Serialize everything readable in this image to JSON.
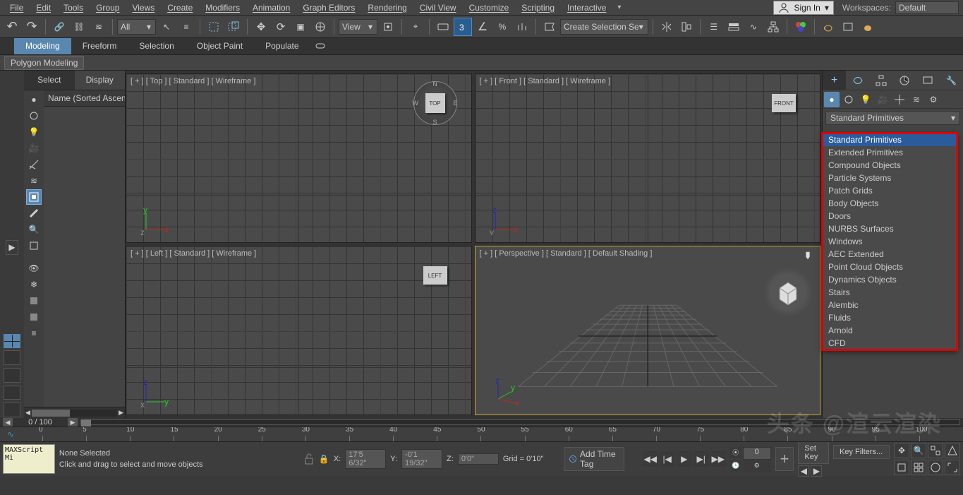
{
  "menubar": {
    "items": [
      "File",
      "Edit",
      "Tools",
      "Group",
      "Views",
      "Create",
      "Modifiers",
      "Animation",
      "Graph Editors",
      "Rendering",
      "Civil View",
      "Customize",
      "Scripting",
      "Interactive"
    ],
    "sign_in": "Sign In",
    "workspaces_label": "Workspaces:",
    "workspace_value": "Default"
  },
  "toolbar": {
    "all_filter": "All",
    "view_filter": "View",
    "named_sel": "Create Selection Se"
  },
  "ribbon": {
    "tabs": [
      "Modeling",
      "Freeform",
      "Selection",
      "Object Paint",
      "Populate"
    ],
    "active": 0,
    "panel": "Polygon Modeling"
  },
  "scene_explorer": {
    "tabs": [
      "Select",
      "Display"
    ],
    "active_tab": 0,
    "column": "Name (Sorted Ascending)"
  },
  "viewports": [
    {
      "label": "[ + ] [ Top ] [ Standard ] [ Wireframe ]",
      "cube": "TOP",
      "active": false
    },
    {
      "label": "[ + ] [ Front ] [ Standard ] [ Wireframe ]",
      "cube": "FRONT",
      "active": false
    },
    {
      "label": "[ + ] [ Left ] [ Standard ] [ Wireframe ]",
      "cube": "LEFT",
      "active": false
    },
    {
      "label": "[ + ] [ Perspective ] [ Standard ] [ Default Shading ]",
      "cube": "",
      "active": true
    }
  ],
  "command_panel": {
    "category_label": "Standard Primitives",
    "dropdown": {
      "items": [
        "Standard Primitives",
        "Extended Primitives",
        "Compound Objects",
        "Particle Systems",
        "Patch Grids",
        "Body Objects",
        "Doors",
        "NURBS Surfaces",
        "Windows",
        "AEC Extended",
        "Point Cloud Objects",
        "Dynamics Objects",
        "Stairs",
        "Alembic",
        "Fluids",
        "Arnold",
        "CFD"
      ],
      "selected": 0
    }
  },
  "timeline": {
    "frame_label": "0 / 100",
    "ruler_major": [
      0,
      5,
      10,
      15,
      20,
      25,
      30,
      35,
      40,
      45,
      50,
      55,
      60,
      65,
      70,
      75,
      80,
      85,
      90,
      95,
      100
    ]
  },
  "status": {
    "maxscript": "MAXScript Mi",
    "selection": "None Selected",
    "prompt": "Click and drag to select and move objects",
    "coords": {
      "x_lbl": "X:",
      "x": "17'5 6/32\"",
      "y_lbl": "Y:",
      "y": "-0'1 19/32\"",
      "z_lbl": "Z:",
      "z": "0'0\""
    },
    "grid": "Grid = 0'10\"",
    "add_time_tag": "Add Time Tag",
    "spinner": "0",
    "set_key": "Set Key",
    "key_filters": "Key Filters..."
  },
  "icons": {
    "undo": "↶",
    "redo": "↷",
    "link": "🔗",
    "unlink": "⛓",
    "cursor": "↖",
    "select": "□",
    "move": "✥",
    "rotate": "⟳",
    "scale": "▣",
    "chevron": "▾",
    "snap": "⬓",
    "angle": "∠",
    "percent": "%",
    "align": "≡",
    "layer": "☰",
    "curve": "∿",
    "render": "⚙",
    "play": "▶",
    "prev": "|◀",
    "next": "▶|",
    "start": "◀◀",
    "end": "▶▶",
    "plus": "+",
    "gear": "⚙",
    "hammer": "🔨",
    "sphere": "●",
    "light": "💡",
    "cam": "🎥",
    "helper": "☼",
    "space": "≋",
    "search": "🔍",
    "eye": "👁",
    "freeze": "❄",
    "sel": "◉",
    "lock": "🔒",
    "tele": "⌖",
    "clock": "🕓",
    "bulb": "💡"
  },
  "watermark": "头条 @渲云渲染"
}
